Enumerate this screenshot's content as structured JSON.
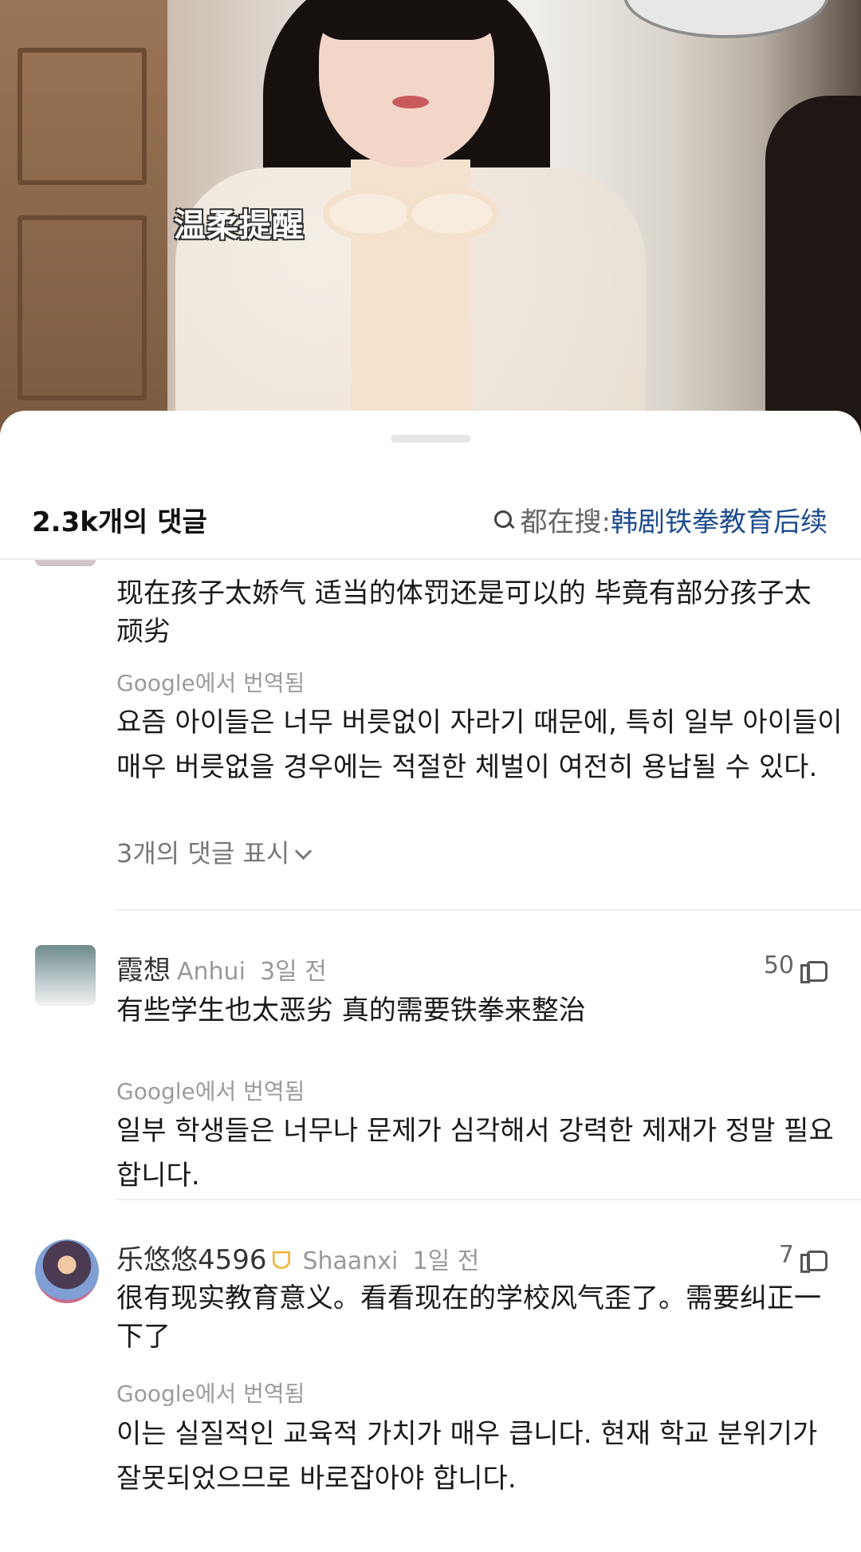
{
  "video": {
    "caption": "温柔提醒"
  },
  "sheet": {
    "comment_count": "2.3k개의 댓글",
    "search_prefix": "都在搜:",
    "search_topic": "韩剧铁拳教育后续"
  },
  "comments": [
    {
      "text": "现在孩子太娇气 适当的体罚还是可以的 毕竟有部分孩子太顽劣",
      "translation_label": "Google에서 번역됨",
      "translation": "요즘 아이들은 너무 버릇없이 자라기 때문에, 특히 일부 아이들이 매우 버릇없을 경우에는 적절한 체벌이 여전히 용납될 수 있다.",
      "replies": "3개의 댓글 표시"
    },
    {
      "user": "霞想",
      "region": "Anhui",
      "time": "3일 전",
      "likes": "50",
      "text": "有些学生也太恶劣 真的需要铁拳来整治",
      "translation_label": "Google에서 번역됨",
      "translation": "일부 학생들은 너무나 문제가 심각해서 강력한 제재가 정말 필요합니다."
    },
    {
      "user": "乐悠悠4596",
      "badge": "ᗜ",
      "region": "Shaanxi",
      "time": "1일 전",
      "likes": "7",
      "text": "很有现实教育意义。看看现在的学校风气歪了。需要纠正一下了",
      "translation_label": "Google에서 번역됨",
      "translation": "이는 실질적인 교육적 가치가 매우 큽니다. 현재 학교 분위기가 잘못되었으므로 바로잡아야 합니다."
    }
  ],
  "icons": {
    "search": "search-icon",
    "like": "thumbs-up-icon",
    "expand": "chevron-down-icon"
  },
  "colors": {
    "topic_link": "#1f4d8e",
    "muted": "#999999"
  }
}
